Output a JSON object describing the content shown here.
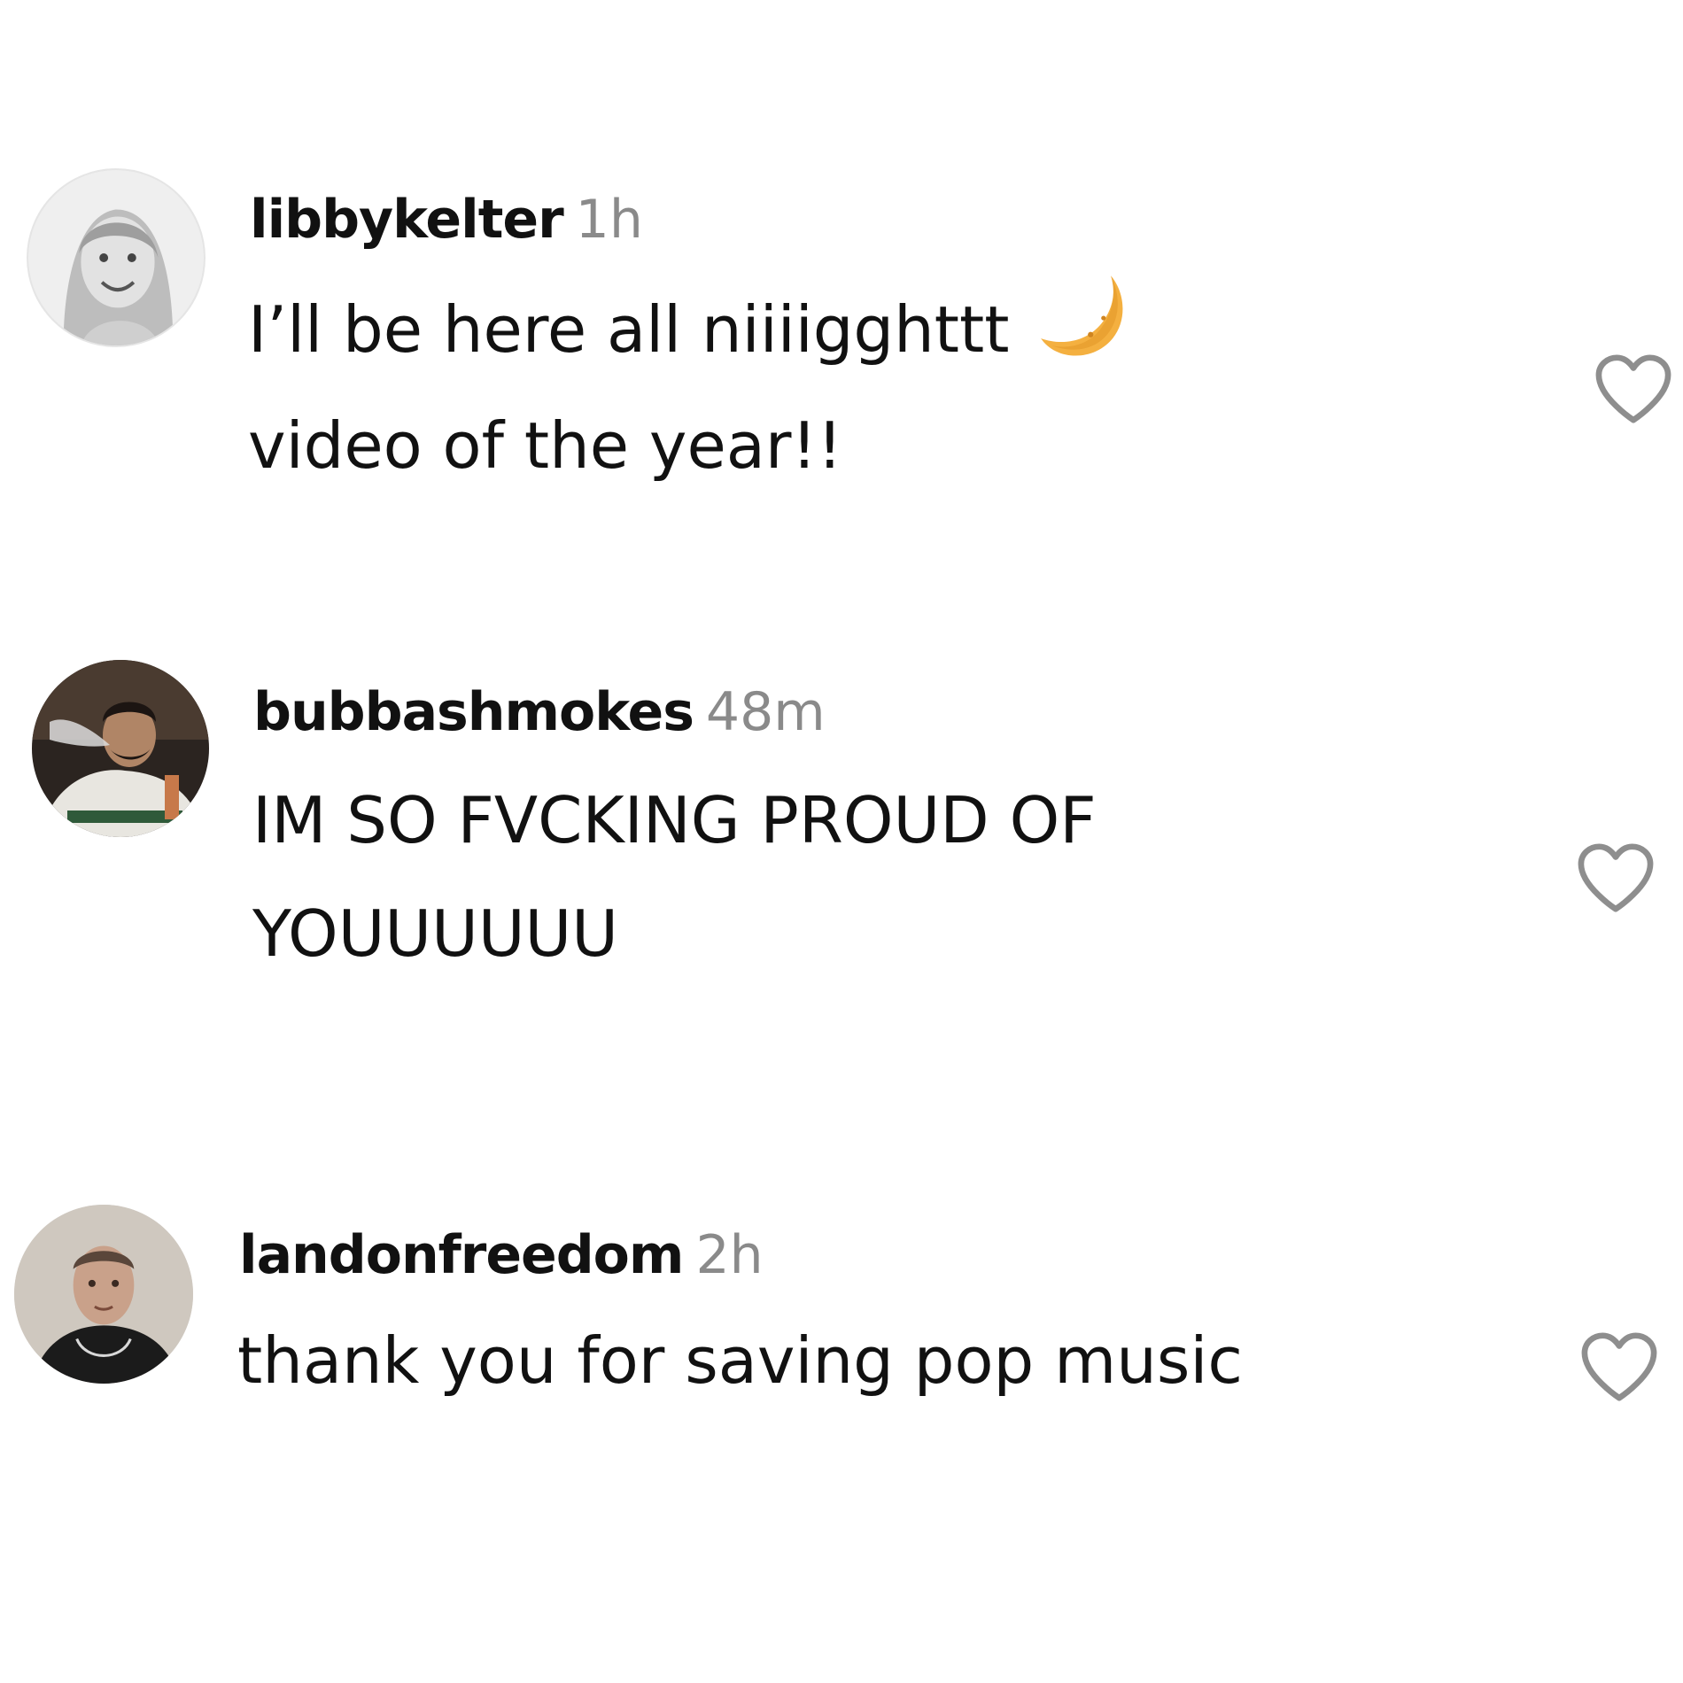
{
  "colors": {
    "text": "#111111",
    "timestamp": "#8a8a8a",
    "heart_outline": "#8e8e8e",
    "moon": "#f4b040"
  },
  "comments": [
    {
      "username": "libbykelter",
      "time": "1h",
      "lines": [
        "I’ll be here all niiiigghttt",
        "video of the year!!"
      ],
      "emoji": "crescent-moon-icon",
      "avatar": "avatar-libbykelter",
      "like_icon": "heart-outline-icon"
    },
    {
      "username": "bubbashmokes",
      "time": "48m",
      "lines": [
        "IM SO FVCKING PROUD OF",
        "YOUUUUUU"
      ],
      "avatar": "avatar-bubbashmokes",
      "like_icon": "heart-outline-icon"
    },
    {
      "username": "landonfreedom",
      "time": "2h",
      "lines": [
        "thank you for saving pop music"
      ],
      "avatar": "avatar-landonfreedom",
      "like_icon": "heart-outline-icon"
    }
  ]
}
